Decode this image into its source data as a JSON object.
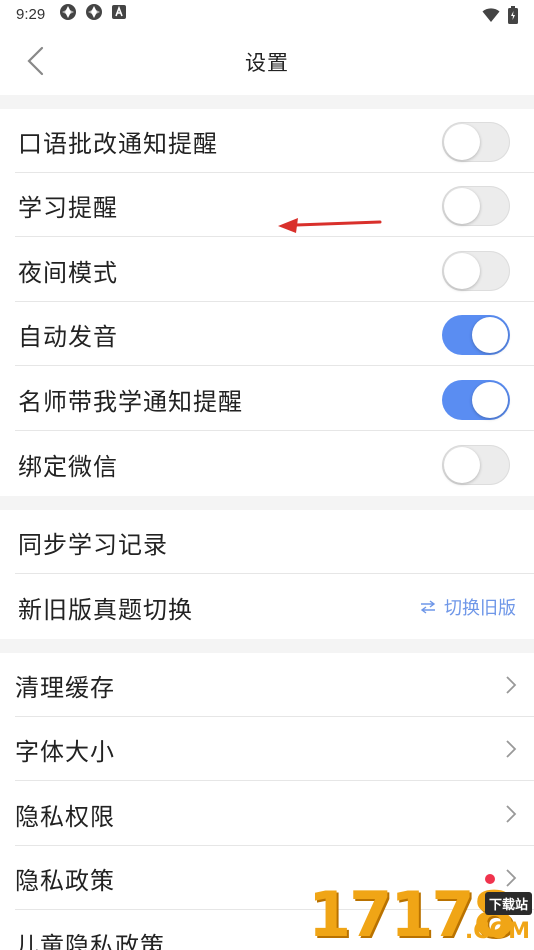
{
  "status_bar": {
    "time": "9:29"
  },
  "header": {
    "title": "设置"
  },
  "toggle_rows": [
    {
      "label": "口语批改通知提醒",
      "on": false
    },
    {
      "label": "学习提醒",
      "on": false
    },
    {
      "label": "夜间模式",
      "on": false
    },
    {
      "label": "自动发音",
      "on": true
    },
    {
      "label": "名师带我学通知提醒",
      "on": true
    },
    {
      "label": "绑定微信",
      "on": false
    }
  ],
  "sync_rows": [
    {
      "label": "同步学习记录"
    },
    {
      "label": "新旧版真题切换",
      "action_label": "切换旧版",
      "action_icon": "swap-arrows-icon"
    }
  ],
  "nav_rows": [
    {
      "label": "清理缓存"
    },
    {
      "label": "字体大小"
    },
    {
      "label": "隐私权限"
    },
    {
      "label": "隐私政策",
      "badge": "red-dot"
    },
    {
      "label": "儿童隐私政策"
    }
  ],
  "watermark": {
    "text": "17178",
    "badge": "下载站",
    "suffix": ".COM"
  },
  "colors": {
    "toggle_on": "#5a8df2",
    "toggle_off": "#ececec",
    "action_text": "#6f97e8",
    "red_dot": "#f0334d",
    "annotation_arrow": "#d9302b",
    "watermark": "#f0a516"
  }
}
